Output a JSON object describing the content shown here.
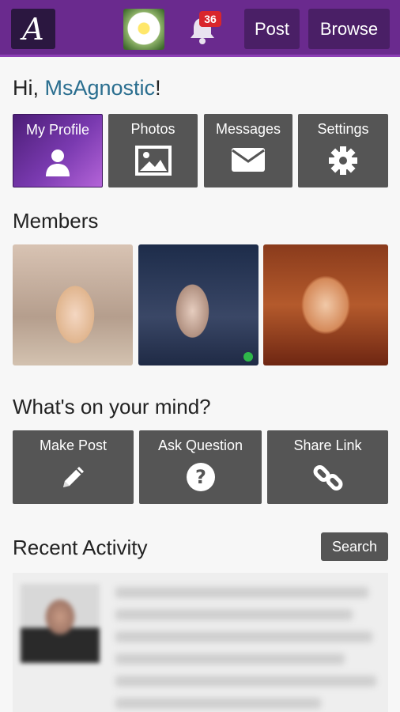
{
  "header": {
    "logo_letter": "A",
    "notification_count": "36",
    "post_label": "Post",
    "browse_label": "Browse"
  },
  "greeting": {
    "prefix": "Hi, ",
    "username": "MsAgnostic",
    "suffix": "!"
  },
  "quick_tiles": [
    {
      "label": "My Profile",
      "icon": "user-icon"
    },
    {
      "label": "Photos",
      "icon": "image-icon"
    },
    {
      "label": "Messages",
      "icon": "envelope-icon"
    },
    {
      "label": "Settings",
      "icon": "gear-icon"
    }
  ],
  "members": {
    "title": "Members",
    "count_visible": 3,
    "online_indicator_on": 2
  },
  "mind": {
    "title": "What's on your mind?",
    "actions": [
      {
        "label": "Make Post",
        "icon": "pencil-icon"
      },
      {
        "label": "Ask Question",
        "icon": "question-icon"
      },
      {
        "label": "Share Link",
        "icon": "link-icon"
      }
    ]
  },
  "activity": {
    "title": "Recent Activity",
    "search_label": "Search"
  },
  "colors": {
    "header_bg": "#6a2a8e",
    "tile_bg": "#555555",
    "username": "#2a6e8f",
    "badge": "#d9262c",
    "online": "#2fb84a"
  }
}
